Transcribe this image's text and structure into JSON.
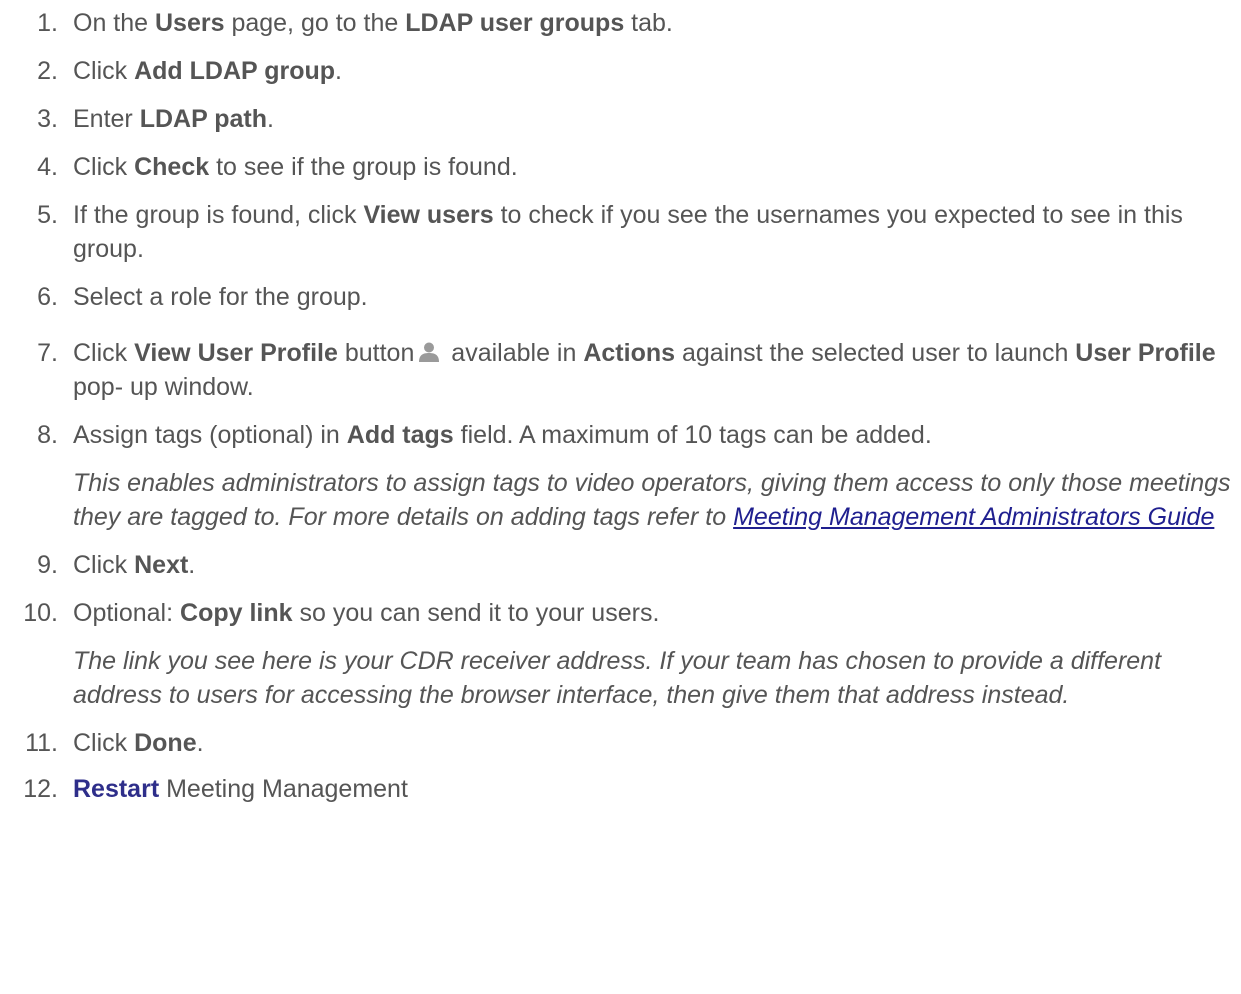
{
  "steps": [
    {
      "num": "1.",
      "p1": "On the ",
      "b1": "Users",
      "p2": " page, go to the ",
      "b2": "LDAP user groups",
      "p3": " tab."
    },
    {
      "num": "2.",
      "p1": "Click ",
      "b1": "Add LDAP group",
      "p2": "."
    },
    {
      "num": "3.",
      "p1": "Enter ",
      "b1": "LDAP path",
      "p2": "."
    },
    {
      "num": "4.",
      "p1": "Click ",
      "b1": "Check",
      "p2": " to see if the group is found."
    },
    {
      "num": "5.",
      "p1": "If the group is found, click ",
      "b1": "View users",
      "p2": " to check if you see the usernames you expected to see in this group."
    },
    {
      "num": "6.",
      "p1": "Select a role for the group."
    },
    {
      "num": "7.",
      "p1": "Click ",
      "b1": "View User Profile",
      "p2": " button",
      "p3": " available in ",
      "b2": "Actions",
      "p4": " against the selected user to launch ",
      "b3": "User Profile",
      "p5": " pop- up window.",
      "icon": "user-profile-icon"
    },
    {
      "num": "8.",
      "p1": "Assign tags (optional) in ",
      "b1": "Add tags",
      "p2": " field. A maximum of 10 tags can be added.",
      "note": " This enables administrators to assign tags to video operators, giving them access to only those meetings they are tagged to.  For more details on adding tags refer to ",
      "link": "Meeting Management Administrators Guide"
    },
    {
      "num": "9.",
      "p1": "Click ",
      "b1": "Next",
      "p2": "."
    },
    {
      "num": "10.",
      "p1": "Optional: ",
      "b1": "Copy link",
      "p2": " so you can send it to your users.",
      "note": "The link you see here is your CDR receiver address. If your team has chosen to provide a different address to users for accessing the browser interface, then give them that address instead."
    },
    {
      "num": "11.",
      "p1": "Click ",
      "b1": "Done",
      "p2": "."
    },
    {
      "num": "12.",
      "b1": "Restart",
      "p1": " Meeting Management"
    }
  ],
  "colors": {
    "text": "#555555",
    "link": "#1f1f8f",
    "restart": "#2e2e8a"
  }
}
